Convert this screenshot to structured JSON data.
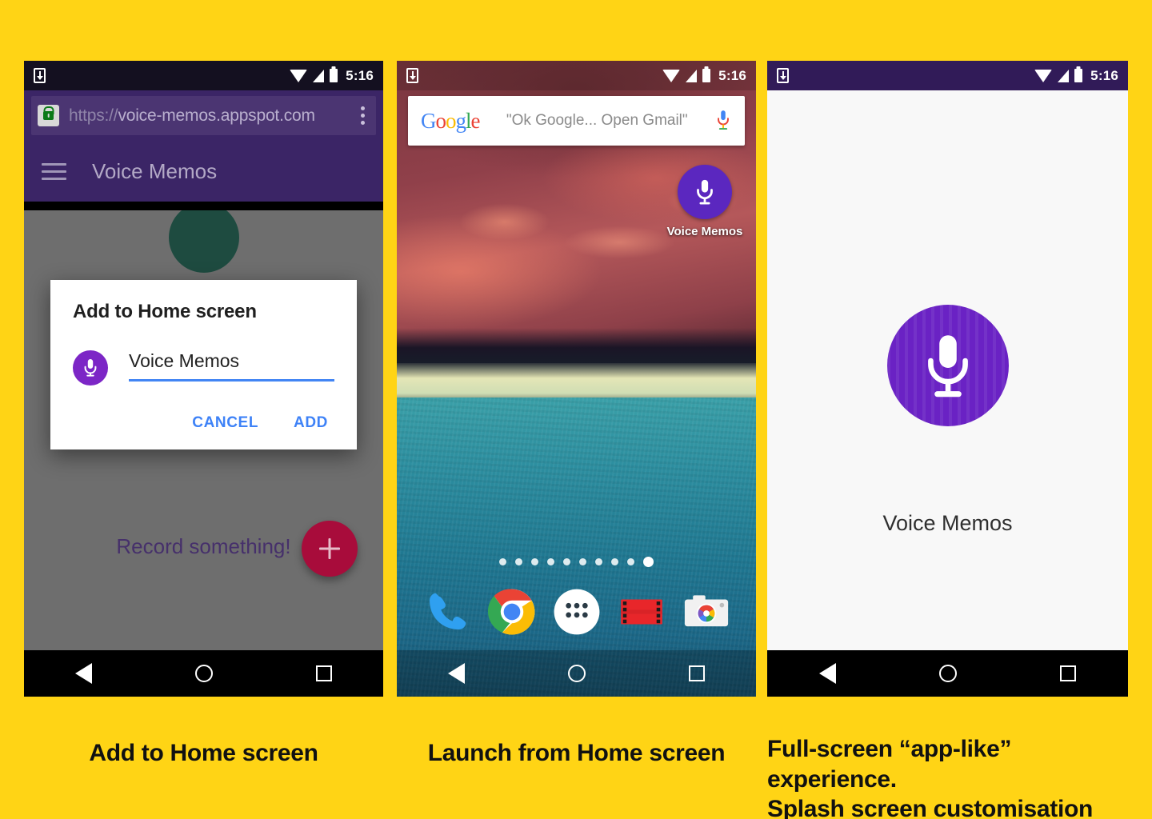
{
  "background_color": "#FFD415",
  "status_bar": {
    "download_icon": "download-icon",
    "wifi_icon": "wifi-icon",
    "signal_icon": "signal-icon",
    "battery_icon": "battery-icon",
    "time": "5:16"
  },
  "nav_bar": {
    "back": "back-triangle-icon",
    "home": "home-circle-icon",
    "recents": "recents-square-icon"
  },
  "phone1": {
    "browser": {
      "lock_icon": "lock-icon",
      "url_scheme": "https://",
      "url_host": "voice-memos.appspot.com",
      "menu_icon": "overflow-menu-icon"
    },
    "app_bar": {
      "menu_icon": "hamburger-menu-icon",
      "title": "Voice Memos"
    },
    "content": {
      "empty_text": "Record something!",
      "fab_icon": "plus-icon"
    },
    "dialog": {
      "title": "Add to Home screen",
      "icon": "microphone-icon",
      "input_value": "Voice Memos",
      "input_placeholder": "Voice Memos",
      "cancel_label": "CANCEL",
      "add_label": "ADD",
      "accent_color": "#4285F4"
    }
  },
  "phone2": {
    "search_widget": {
      "logo": "Google",
      "logo_letters": [
        "G",
        "o",
        "o",
        "g",
        "l",
        "e"
      ],
      "hint": "\"Ok Google... Open Gmail\"",
      "mic_icon": "microphone-icon"
    },
    "home_icon": {
      "icon": "microphone-icon",
      "label": "Voice Memos",
      "color": "#5B27BF"
    },
    "page_dots": {
      "count": 10,
      "active_index": 9
    },
    "dock": [
      {
        "name": "phone-icon",
        "label": "Phone"
      },
      {
        "name": "chrome-icon",
        "label": "Chrome"
      },
      {
        "name": "app-drawer-icon",
        "label": "All apps"
      },
      {
        "name": "play-movies-icon",
        "label": "Play Movies"
      },
      {
        "name": "camera-icon",
        "label": "Camera"
      }
    ]
  },
  "phone3": {
    "splash": {
      "icon": "microphone-icon",
      "label": "Voice Memos",
      "icon_color": "#6A22C4",
      "background": "#F8F8F8"
    }
  },
  "captions": {
    "one": "Add to Home screen",
    "two": "Launch from Home screen",
    "three_line1": "Full-screen “app-like” experience.",
    "three_line2": "Splash screen customisation"
  }
}
